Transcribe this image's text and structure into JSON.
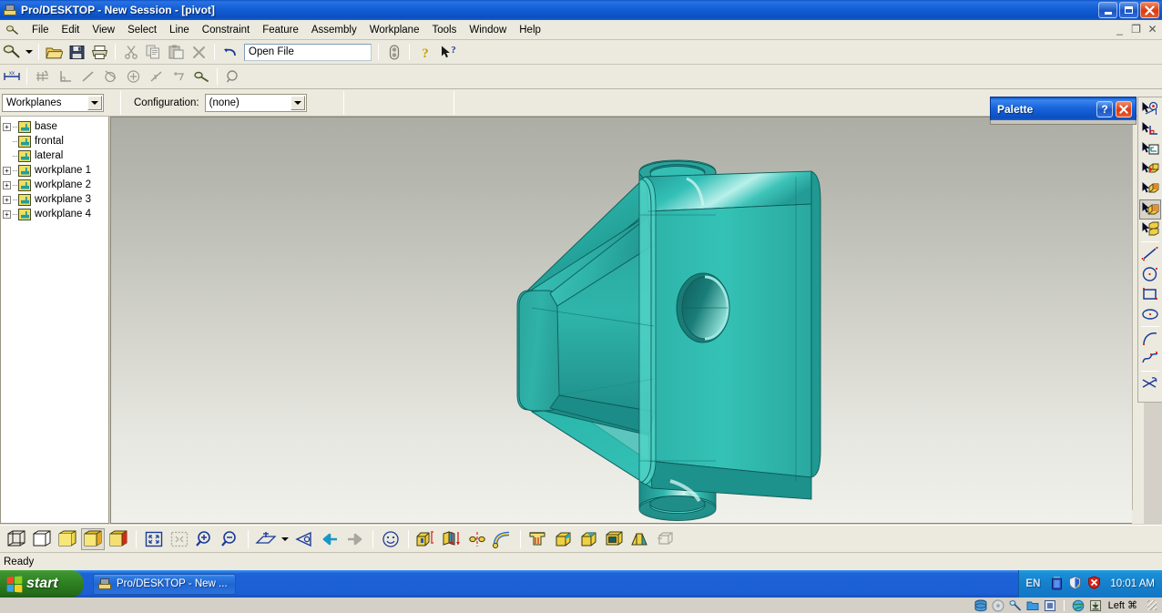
{
  "window": {
    "title": "Pro/DESKTOP - New Session - [pivot]",
    "app_icon": "prodesktop-icon",
    "minimize_label": "_",
    "restore_label": "❐",
    "close_label": "✕",
    "mdi_minimize": "_",
    "mdi_restore": "❐",
    "mdi_close": "✕"
  },
  "menu": {
    "items": [
      {
        "label": "File"
      },
      {
        "label": "Edit"
      },
      {
        "label": "View"
      },
      {
        "label": "Select"
      },
      {
        "label": "Line"
      },
      {
        "label": "Constraint"
      },
      {
        "label": "Feature"
      },
      {
        "label": "Assembly"
      },
      {
        "label": "Workplane"
      },
      {
        "label": "Tools"
      },
      {
        "label": "Window"
      },
      {
        "label": "Help"
      }
    ]
  },
  "toolbar_main": {
    "buttons": [
      {
        "name": "design-mode-icon",
        "title": "Design"
      },
      {
        "name": "dropdown-arrow-icon",
        "title": "More"
      },
      {
        "name": "open-icon",
        "title": "Open"
      },
      {
        "name": "save-icon",
        "title": "Save"
      },
      {
        "name": "print-icon",
        "title": "Print"
      },
      {
        "name": "cut-icon",
        "title": "Cut"
      },
      {
        "name": "copy-icon",
        "title": "Copy"
      },
      {
        "name": "paste-icon",
        "title": "Paste"
      },
      {
        "name": "delete-icon",
        "title": "Delete"
      },
      {
        "name": "undo-icon",
        "title": "Undo"
      },
      {
        "name": "toggle-icon",
        "title": "Toggle"
      },
      {
        "name": "help-icon",
        "title": "Help"
      },
      {
        "name": "context-help-icon",
        "title": "What's This"
      }
    ],
    "open_file_value": "Open File"
  },
  "toolbar_constraint": {
    "buttons": [
      {
        "name": "dimension-icon",
        "title": "Dimension"
      },
      {
        "name": "coincident-icon",
        "title": "Coincident"
      },
      {
        "name": "perpendicular-icon",
        "title": "Perpendicular"
      },
      {
        "name": "line-icon",
        "title": "Line"
      },
      {
        "name": "tangent-icon",
        "title": "Tangent"
      },
      {
        "name": "concentric-icon",
        "title": "Concentric"
      },
      {
        "name": "equal-icon",
        "title": "Equal"
      },
      {
        "name": "parallel-icon",
        "title": "Parallel"
      },
      {
        "name": "fix-icon",
        "title": "Fix"
      },
      {
        "name": "inspect-icon",
        "title": "Inspect"
      }
    ]
  },
  "config_bar": {
    "workplanes_value": "Workplanes",
    "configuration_label": "Configuration:",
    "configuration_value": "(none)"
  },
  "tree": {
    "nodes": [
      {
        "label": "base",
        "expandable": true,
        "expander": "+",
        "icon": "workplane-icon"
      },
      {
        "label": "frontal",
        "expandable": false,
        "expander": "",
        "icon": "workplane-icon"
      },
      {
        "label": "lateral",
        "expandable": false,
        "expander": "",
        "icon": "workplane-icon"
      },
      {
        "label": "workplane 1",
        "expandable": true,
        "expander": "+",
        "icon": "workplane-icon"
      },
      {
        "label": "workplane 2",
        "expandable": true,
        "expander": "+",
        "icon": "workplane-icon"
      },
      {
        "label": "workplane 3",
        "expandable": true,
        "expander": "+",
        "icon": "workplane-icon"
      },
      {
        "label": "workplane 4",
        "expandable": true,
        "expander": "+",
        "icon": "workplane-icon"
      }
    ]
  },
  "palette": {
    "title": "Palette",
    "help_label": "?",
    "close_label": "✕"
  },
  "viewport": {
    "model_name": "pivot",
    "model_color": "#2fb9ae",
    "model_color_dark": "#1c8f8a",
    "model_color_light": "#a8ece6",
    "edge_color": "#0f5f5c",
    "background_top": "#acaea6",
    "background_bottom": "#f1f1ec"
  },
  "right_toolbar": {
    "buttons": [
      {
        "name": "select-point-icon",
        "title": "Select point"
      },
      {
        "name": "select-line-icon",
        "title": "Select line"
      },
      {
        "name": "select-workplane-icon",
        "title": "Select workplane"
      },
      {
        "name": "select-face-icon",
        "title": "Select face"
      },
      {
        "name": "select-solid-icon",
        "title": "Select solid"
      },
      {
        "name": "select-part-icon",
        "title": "Select part",
        "selected": true
      },
      {
        "name": "select-assembly-icon",
        "title": "Select assembly"
      },
      {
        "name": "draw-line-icon",
        "title": "Line"
      },
      {
        "name": "draw-circle-icon",
        "title": "Circle"
      },
      {
        "name": "draw-rectangle-icon",
        "title": "Rectangle"
      },
      {
        "name": "draw-ellipse-icon",
        "title": "Ellipse"
      },
      {
        "name": "draw-arc-icon",
        "title": "Arc"
      },
      {
        "name": "draw-spline-icon",
        "title": "Spline"
      },
      {
        "name": "trim-icon",
        "title": "Trim"
      }
    ]
  },
  "bottom_toolbar": {
    "buttons": [
      {
        "name": "wireframe-view-icon",
        "title": "Wireframe"
      },
      {
        "name": "hidden-line-view-icon",
        "title": "Hidden line"
      },
      {
        "name": "shaded-flat-icon",
        "title": "Shaded flat"
      },
      {
        "name": "shaded-smooth-icon",
        "title": "Shaded",
        "selected": true
      },
      {
        "name": "shaded-albedo-icon",
        "title": "Enhanced shading"
      },
      {
        "name": "zoom-fit-icon",
        "title": "Zoom to fit"
      },
      {
        "name": "zoom-selection-icon",
        "title": "Zoom selection"
      },
      {
        "name": "zoom-in-icon",
        "title": "Zoom in"
      },
      {
        "name": "zoom-out-icon",
        "title": "Zoom out"
      },
      {
        "name": "workplane-view-icon",
        "title": "Workplane view"
      },
      {
        "name": "view-dropdown-icon",
        "title": "Views"
      },
      {
        "name": "eye-view-icon",
        "title": "Viewpoint"
      },
      {
        "name": "previous-view-icon",
        "title": "Previous view"
      },
      {
        "name": "next-view-icon",
        "title": "Next view"
      },
      {
        "name": "render-icon",
        "title": "Render"
      },
      {
        "name": "extrude-icon",
        "title": "Extrude"
      },
      {
        "name": "revolve-icon",
        "title": "Revolve"
      },
      {
        "name": "loft-icon",
        "title": "Loft"
      },
      {
        "name": "sweep-icon",
        "title": "Sweep"
      },
      {
        "name": "material-icon",
        "title": "Material"
      },
      {
        "name": "round-edge-icon",
        "title": "Round edge"
      },
      {
        "name": "chamfer-edge-icon",
        "title": "Chamfer edge"
      },
      {
        "name": "shell-icon",
        "title": "Shell"
      },
      {
        "name": "draft-icon",
        "title": "Draft"
      },
      {
        "name": "project-icon",
        "title": "Project"
      }
    ]
  },
  "status_bar": {
    "text": "Ready"
  },
  "taskbar": {
    "start_label": "start",
    "tasks": [
      {
        "label": "Pro/DESKTOP - New ...",
        "icon": "prodesktop-icon",
        "active": true
      }
    ],
    "tray": {
      "language": "EN",
      "icons": [
        {
          "name": "battery-icon"
        },
        {
          "name": "antivirus-shield-icon"
        },
        {
          "name": "security-alert-icon"
        }
      ],
      "time": "10:01 AM"
    }
  },
  "dock_strip": {
    "icons": [
      {
        "name": "database-icon"
      },
      {
        "name": "disc-icon"
      },
      {
        "name": "pen-icon"
      },
      {
        "name": "folder-icon"
      },
      {
        "name": "chip-icon"
      },
      {
        "name": "globe-icon"
      },
      {
        "name": "download-icon"
      }
    ],
    "label": "Left ⌘"
  }
}
